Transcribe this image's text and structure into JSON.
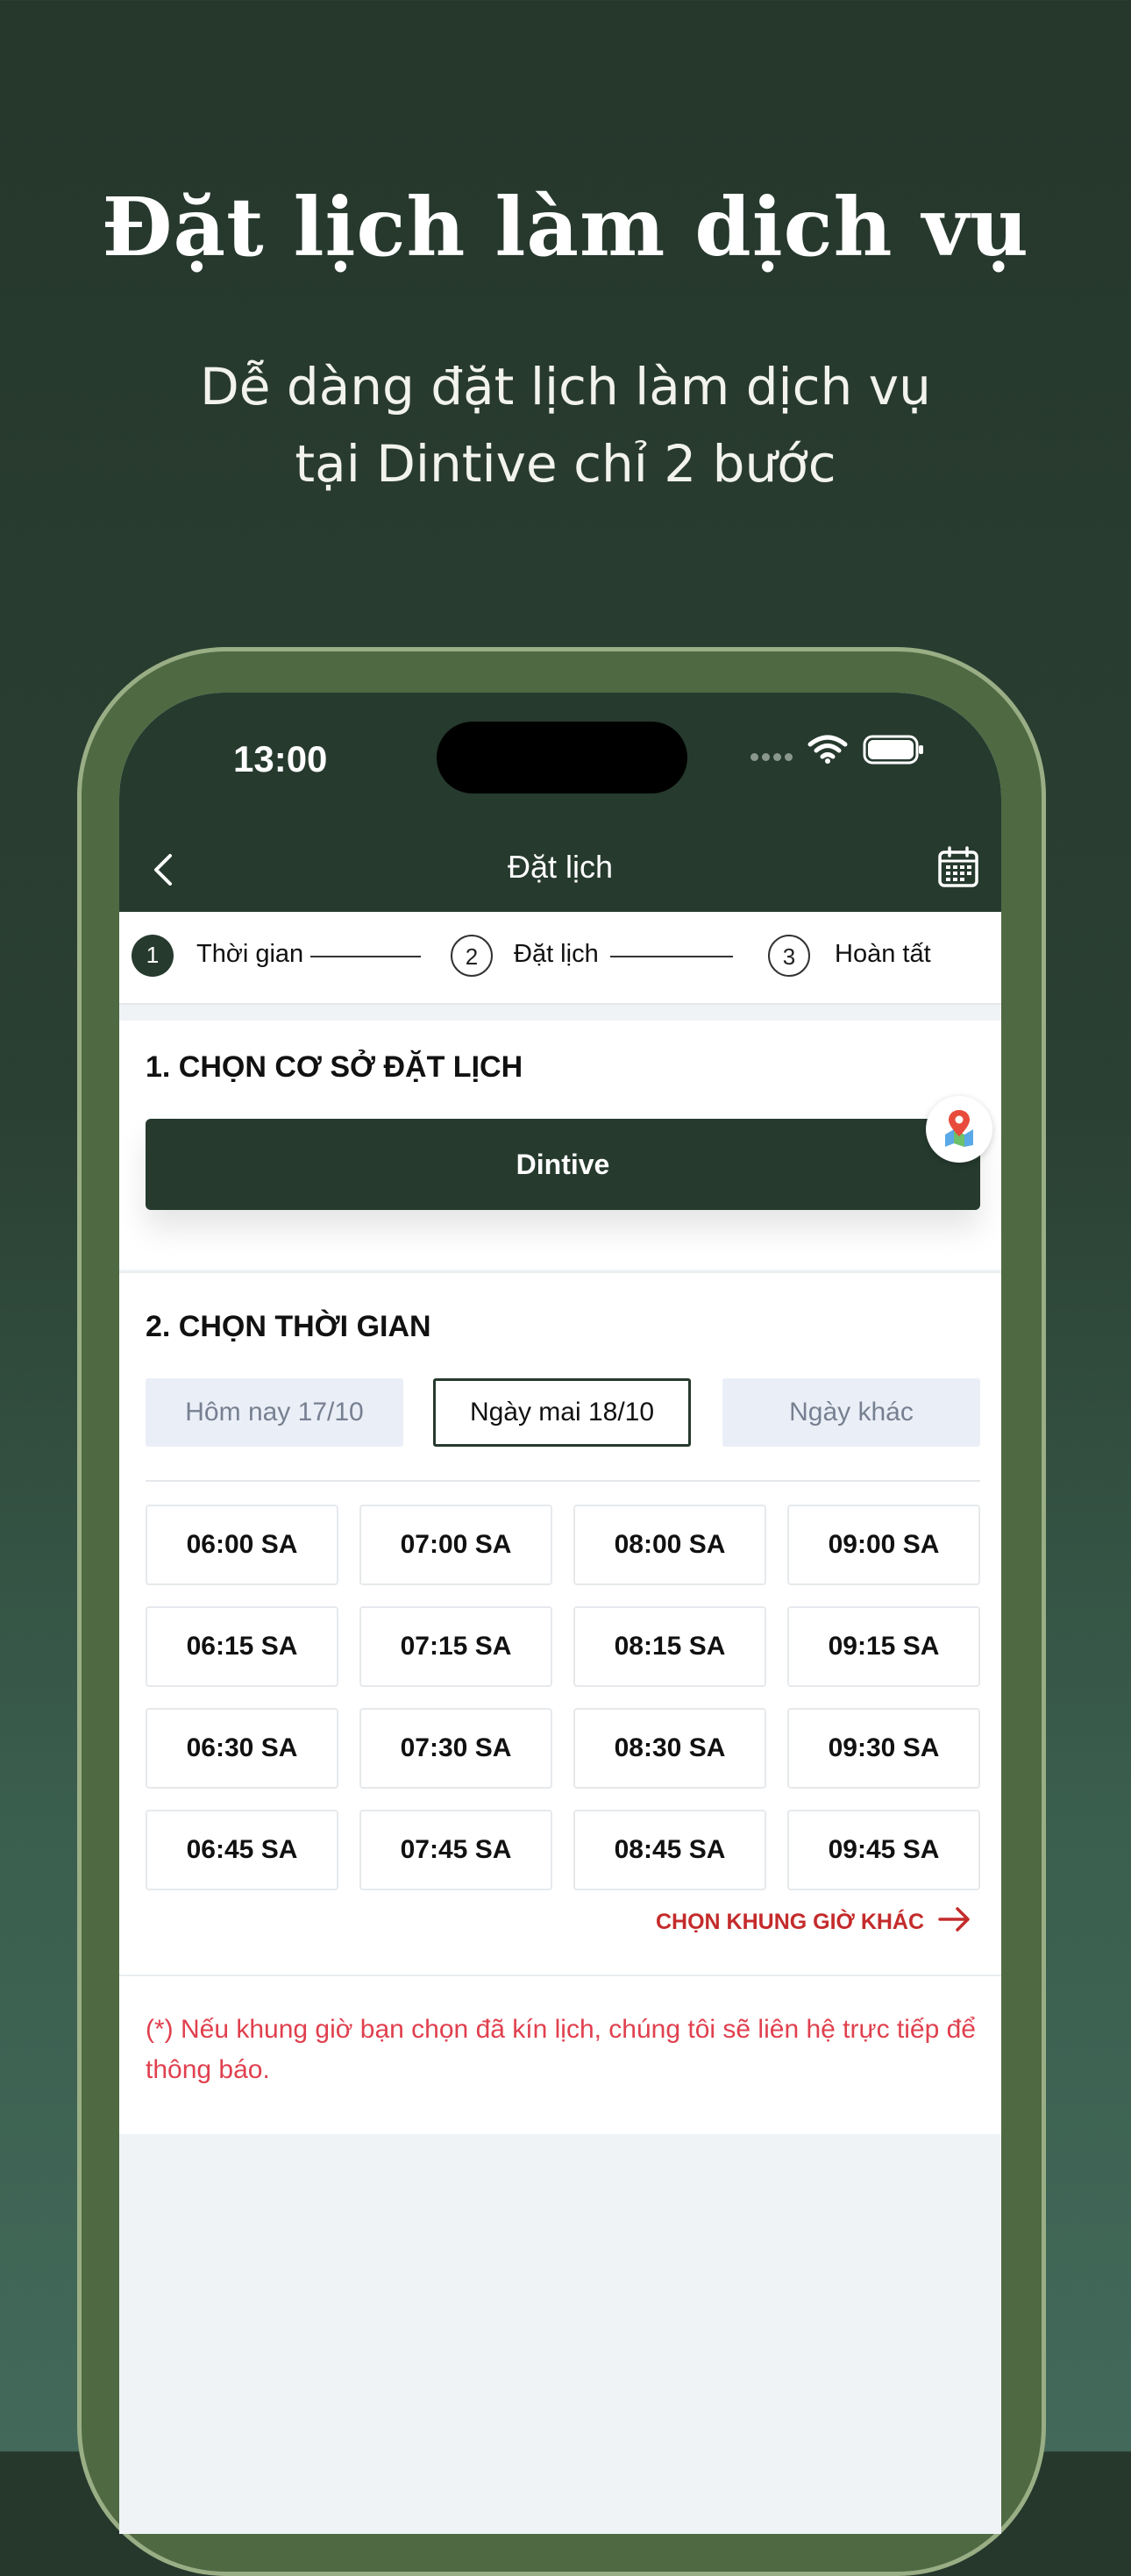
{
  "hero": {
    "title": "Đặt lịch làm dịch vụ",
    "subtitle_line1": "Dễ dàng đặt lịch làm dịch vụ",
    "subtitle_line2": "tại Dintive chỉ 2 bước"
  },
  "status_bar": {
    "time": "13:00"
  },
  "nav": {
    "title": "Đặt lịch"
  },
  "stepper": {
    "steps": [
      {
        "num": "1",
        "label": "Thời gian",
        "active": true
      },
      {
        "num": "2",
        "label": "Đặt lịch",
        "active": false
      },
      {
        "num": "3",
        "label": "Hoàn tất",
        "active": false
      }
    ]
  },
  "branch_section": {
    "title": "1. CHỌN CƠ SỞ ĐẶT LỊCH",
    "selected_branch": "Dintive"
  },
  "time_section": {
    "title": "2. CHỌN THỜI GIAN",
    "date_tabs": [
      "Hôm nay 17/10",
      "Ngày mai 18/10",
      "Ngày khác"
    ],
    "selected_date_index": 1,
    "slots": [
      [
        "06:00 SA",
        "07:00 SA",
        "08:00 SA",
        "09:00 SA"
      ],
      [
        "06:15 SA",
        "07:15 SA",
        "08:15 SA",
        "09:15 SA"
      ],
      [
        "06:30 SA",
        "07:30 SA",
        "08:30 SA",
        "09:30 SA"
      ],
      [
        "06:45 SA",
        "07:45 SA",
        "08:45 SA",
        "09:45 SA"
      ]
    ],
    "more_link": "CHỌN KHUNG GIỜ KHÁC"
  },
  "note": {
    "text": "(*) Nếu khung giờ bạn chọn đã kín lịch, chúng tôi sẽ liên hệ trực tiếp để thông báo."
  },
  "colors": {
    "brand_dark": "#263a2e",
    "frame_green": "#4f6a42",
    "note_red": "#e0404e",
    "link_red": "#c42b2b"
  }
}
